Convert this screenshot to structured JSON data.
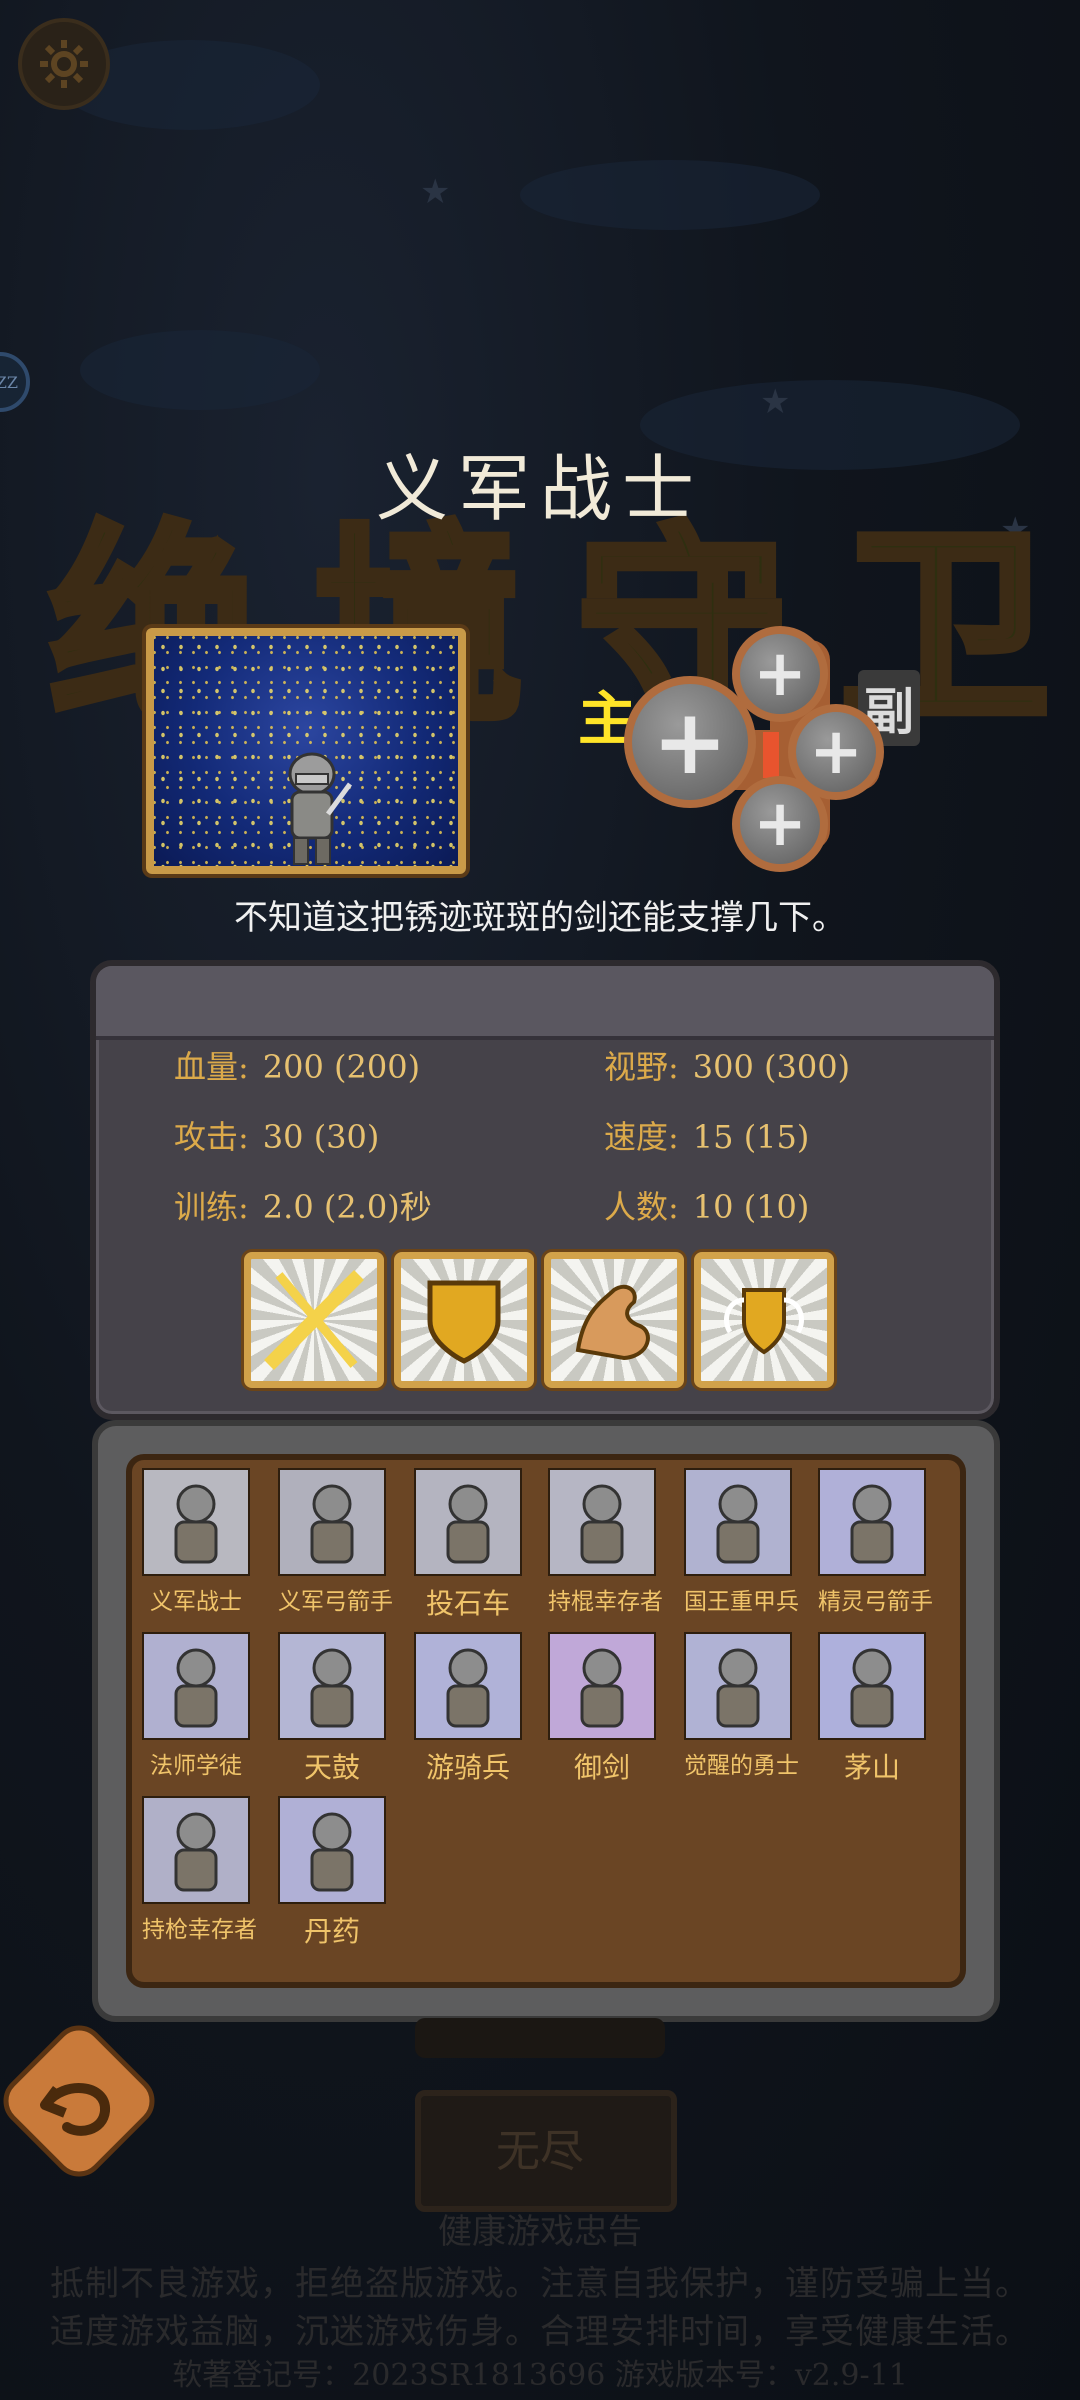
{
  "unit": {
    "name": "义军战士",
    "description": "不知道这把锈迹斑斑的剑还能支撑几下。"
  },
  "background_title": [
    "绝",
    "境",
    "守",
    "卫"
  ],
  "weapon_slots": {
    "main_label": "主",
    "sub_label": "副"
  },
  "side_badge": "ZZ",
  "stats": {
    "hp_label": "血量:",
    "hp_value": "200 (200)",
    "vision_label": "视野:",
    "vision_value": "300 (300)",
    "attack_label": "攻击:",
    "attack_value": "30 (30)",
    "speed_label": "速度:",
    "speed_value": "15 (15)",
    "train_label": "训练:",
    "train_value": "2.0 (2.0)秒",
    "count_label": "人数:",
    "count_value": "10 (10)"
  },
  "skills": [
    "slash-skill-icon",
    "shield-skill-icon",
    "muscle-skill-icon",
    "winged-shield-skill-icon"
  ],
  "roster": [
    {
      "label": "义军战士"
    },
    {
      "label": "义军弓箭手"
    },
    {
      "label": "投石车"
    },
    {
      "label": "持棍幸存者"
    },
    {
      "label": "国王重甲兵"
    },
    {
      "label": "精灵弓箭手"
    },
    {
      "label": "法师学徒"
    },
    {
      "label": "天鼓"
    },
    {
      "label": "游骑兵"
    },
    {
      "label": "御剑"
    },
    {
      "label": "觉醒的勇士"
    },
    {
      "label": "茅山"
    },
    {
      "label": "持枪幸存者"
    },
    {
      "label": "丹药"
    }
  ],
  "endless_label": "无尽",
  "footer": {
    "line1": "健康游戏忠告",
    "line2": "抵制不良游戏，拒绝盗版游戏。注意自我保护，谨防受骗上当。",
    "line3": "适度游戏益脑，沉迷游戏伤身。合理安排时间，享受健康生活。",
    "line4": "软著登记号：2023SR1813696      游戏版本号：v2.9-11"
  },
  "colors": {
    "gold": "#dcaa4a",
    "brown": "#6a4524",
    "accent_yellow": "#ffe428"
  }
}
